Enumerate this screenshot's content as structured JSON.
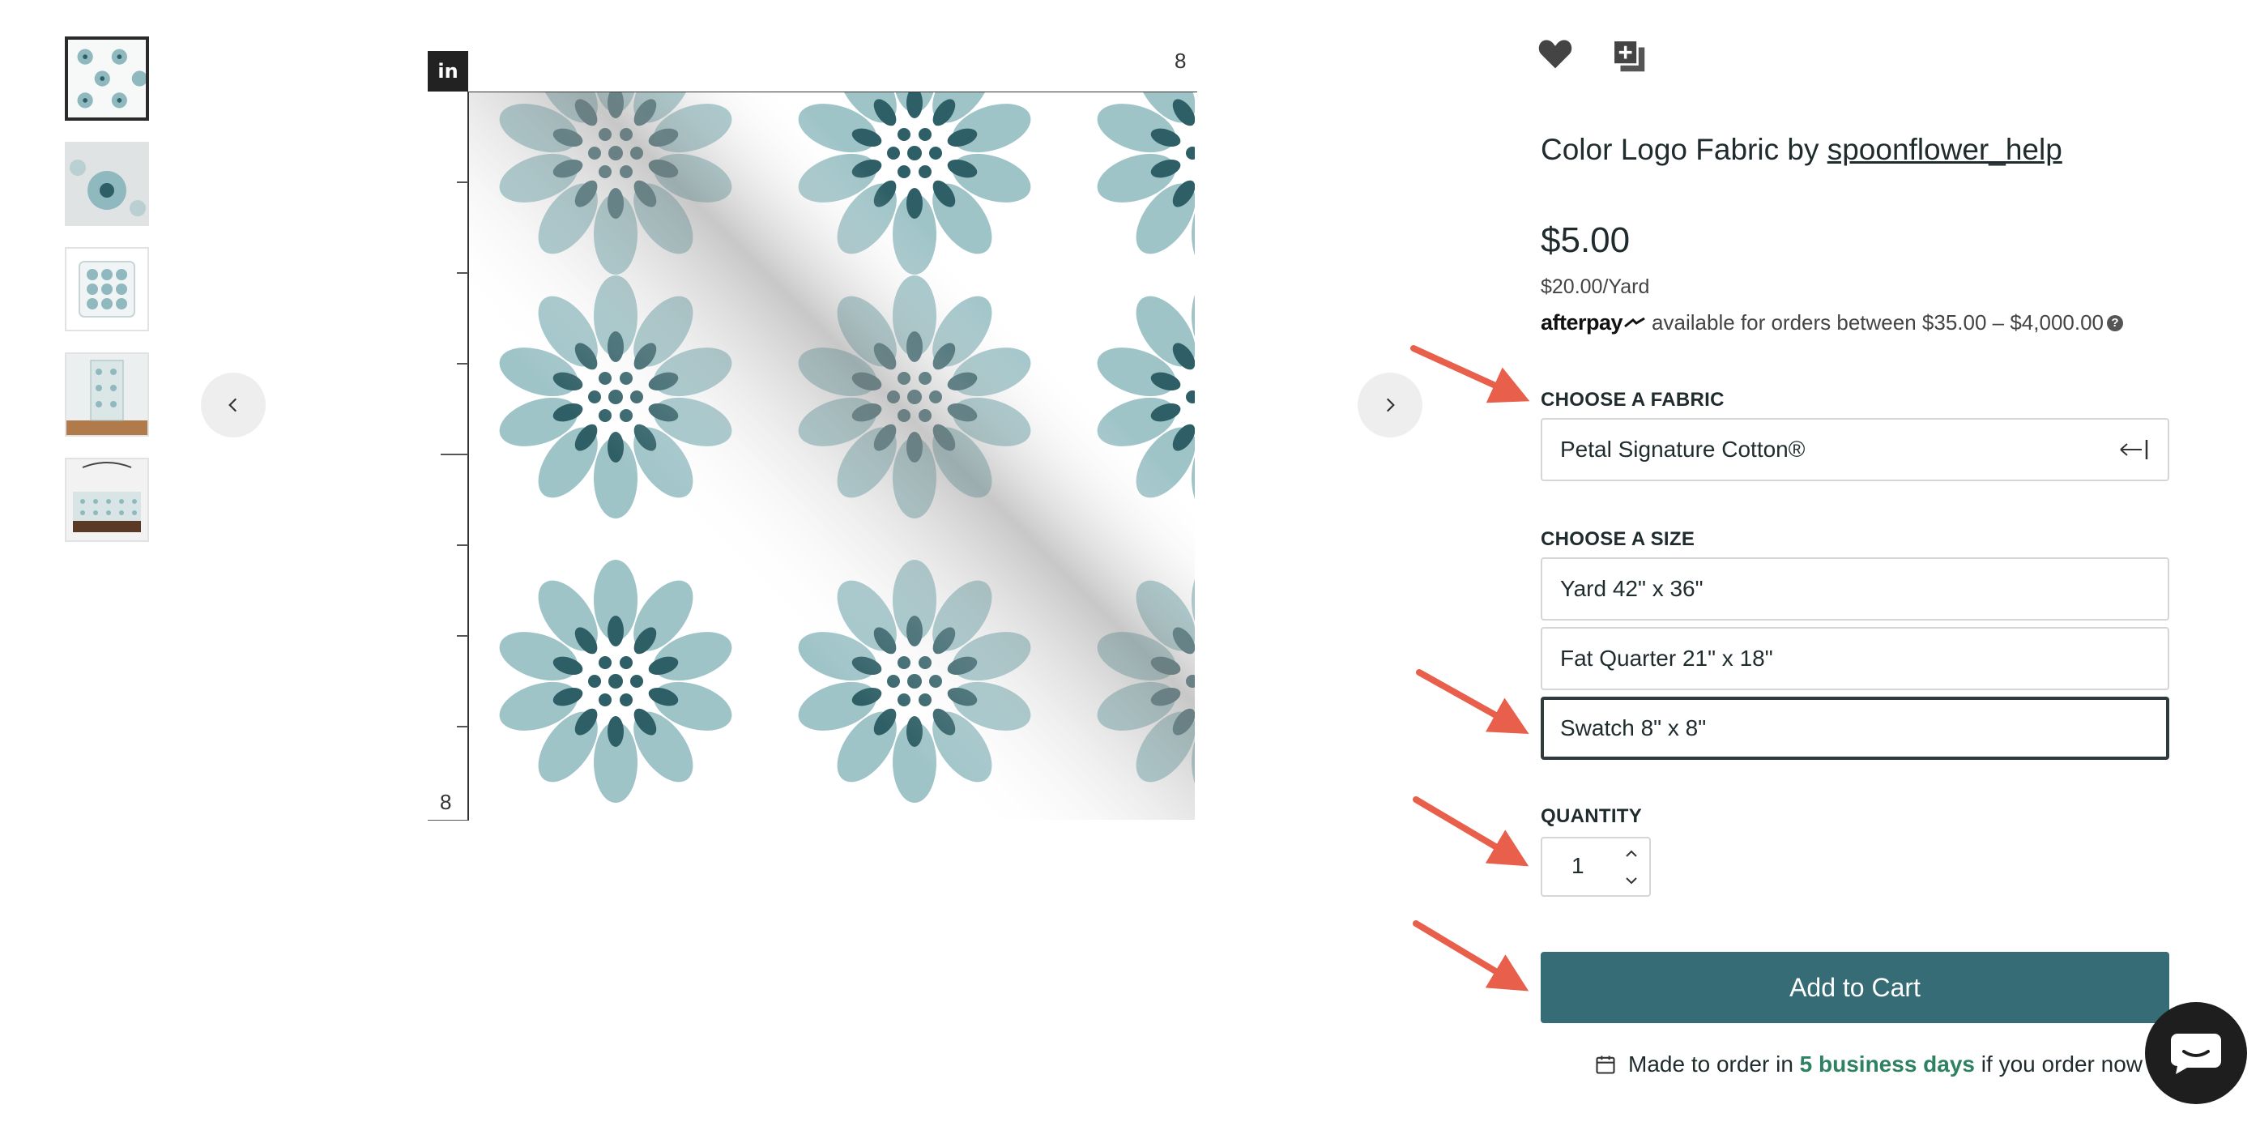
{
  "thumbnails": [
    {
      "label": "fabric-swatch"
    },
    {
      "label": "fabric-closeup"
    },
    {
      "label": "pillow"
    },
    {
      "label": "blanket"
    },
    {
      "label": "duvet-bedroom"
    }
  ],
  "ruler": {
    "unit": "in",
    "top_end": "8",
    "left_end": "8"
  },
  "product": {
    "title_prefix": "Color Logo Fabric by ",
    "designer": "spoonflower_help",
    "price": "$5.00",
    "unit_price": "$20.00/Yard",
    "afterpay_logo": "afterpay",
    "afterpay_text": "available for orders between $35.00 – $4,000.00"
  },
  "fabric": {
    "label": "CHOOSE A FABRIC",
    "value": "Petal Signature Cotton®"
  },
  "size": {
    "label": "CHOOSE A SIZE",
    "options": [
      "Yard 42\" x 36\"",
      "Fat Quarter 21\" x 18\"",
      "Swatch 8\" x 8\""
    ],
    "selected_index": 2
  },
  "quantity": {
    "label": "QUANTITY",
    "value": "1"
  },
  "cart": {
    "label": "Add to Cart"
  },
  "order_note": {
    "prefix": "Made to order in ",
    "highlight": "5 business days",
    "suffix": " if you order now"
  },
  "icons": {
    "favorite": "heart-icon",
    "add_to_collection": "add-collection-icon",
    "prev": "chevron-left-icon",
    "next": "chevron-right-icon",
    "chat": "chat-icon",
    "calendar": "calendar-icon"
  },
  "colors": {
    "accent": "#356c75",
    "highlight_green": "#2d8262",
    "annotation_arrow": "#e8604c",
    "petal_light": "#9fc4c8",
    "petal_dark": "#2f5f66"
  }
}
